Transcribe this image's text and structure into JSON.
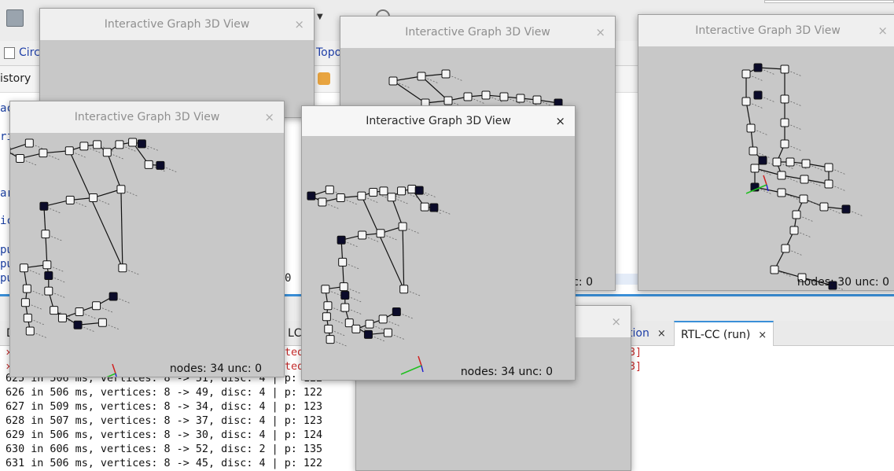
{
  "ide": {
    "tabs": {
      "circ": "Circ",
      "topo": "Topo"
    },
    "history": "istory",
    "editor_frags": [
      "ac",
      "ri",
      "ar",
      "ic",
      "pu",
      "pu",
      "pu",
      "0"
    ],
    "output_tabs": {
      "left": "D",
      "lci": "LCi",
      "tion": "tion",
      "active": "RTL-CC (run)"
    },
    "error_frags": [
      "ted",
      "ted",
      "3]",
      "3]"
    ],
    "output_lines": [
      "625 in 506 ms, vertices: 8 -> 51, disc: 4 | p: 122",
      "626 in 506 ms, vertices: 8 -> 49, disc: 4 | p: 122",
      "627 in 509 ms, vertices: 8 -> 34, disc: 4 | p: 123",
      "628 in 507 ms, vertices: 8 -> 37, disc: 4 | p: 123",
      "629 in 506 ms, vertices: 8 -> 30, disc: 4 | p: 124",
      "630 in 606 ms, vertices: 8 -> 52, disc: 2 | p: 135",
      "631 in 506 ms, vertices: 8 -> 45, disc: 4 | p: 122"
    ]
  },
  "windows": {
    "title": "Interactive Graph 3D View",
    "close": "×",
    "w_top_left": {
      "footer": ""
    },
    "w_top_mid": {
      "footer": "c: 0"
    },
    "w_right": {
      "footer": "nodes: 30 unc: 0"
    },
    "w_left": {
      "footer": "nodes: 34 unc: 0"
    },
    "w_center": {
      "footer": "nodes: 34 unc: 0"
    },
    "w_bottom": {
      "footer": ""
    }
  }
}
